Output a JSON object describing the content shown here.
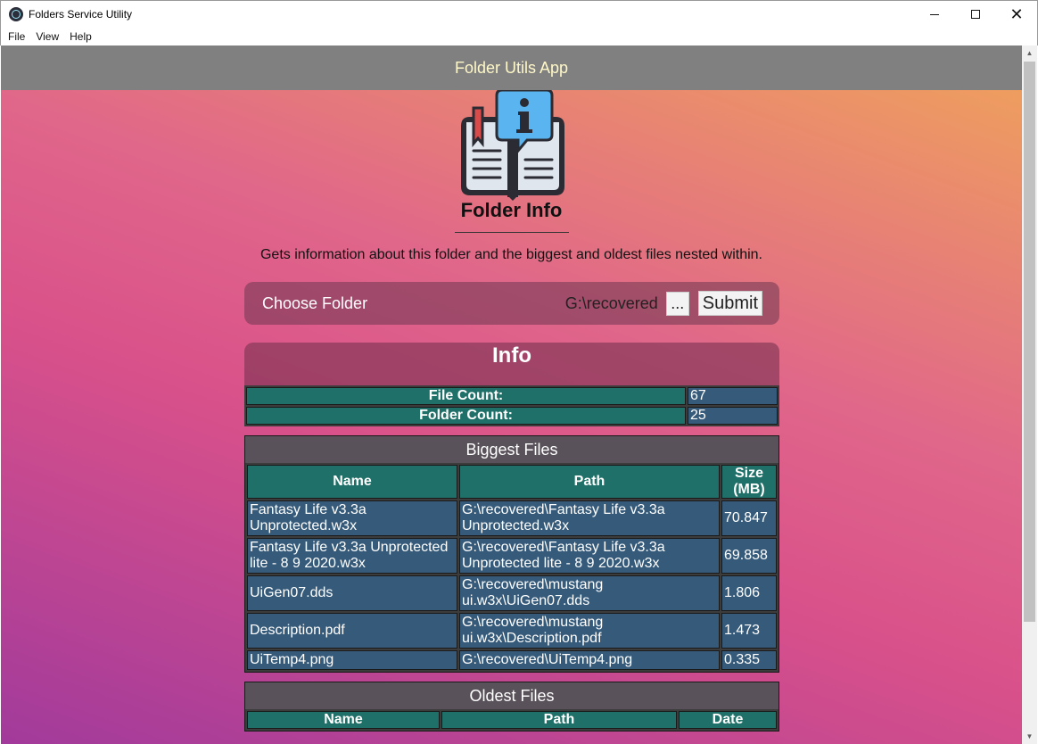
{
  "window": {
    "title": "Folders Service Utility"
  },
  "menu": [
    "File",
    "View",
    "Help"
  ],
  "header": {
    "title": "Folder Utils App"
  },
  "page": {
    "heading": "Folder Info",
    "description": "Gets information about this folder and the biggest and oldest files nested within."
  },
  "chooser": {
    "label": "Choose Folder",
    "path": "G:\\recovered",
    "browse_label": "...",
    "submit_label": "Submit"
  },
  "info": {
    "title": "Info",
    "rows": [
      {
        "label": "File Count:",
        "value": "67"
      },
      {
        "label": "Folder Count:",
        "value": "25"
      }
    ]
  },
  "biggest": {
    "title": "Biggest Files",
    "columns": [
      "Name",
      "Path",
      "Size (MB)"
    ],
    "rows": [
      {
        "name": "Fantasy Life v3.3a Unprotected.w3x",
        "path": "G:\\recovered\\Fantasy Life v3.3a Unprotected.w3x",
        "size": "70.847"
      },
      {
        "name": "Fantasy Life v3.3a Unprotected lite - 8 9 2020.w3x",
        "path": "G:\\recovered\\Fantasy Life v3.3a Unprotected lite - 8 9 2020.w3x",
        "size": "69.858"
      },
      {
        "name": "UiGen07.dds",
        "path": "G:\\recovered\\mustang ui.w3x\\UiGen07.dds",
        "size": "1.806"
      },
      {
        "name": "Description.pdf",
        "path": "G:\\recovered\\mustang ui.w3x\\Description.pdf",
        "size": "1.473"
      },
      {
        "name": "UiTemp4.png",
        "path": "G:\\recovered\\UiTemp4.png",
        "size": "0.335"
      }
    ]
  },
  "oldest": {
    "title": "Oldest Files",
    "columns": [
      "Name",
      "Path",
      "Date"
    ]
  }
}
